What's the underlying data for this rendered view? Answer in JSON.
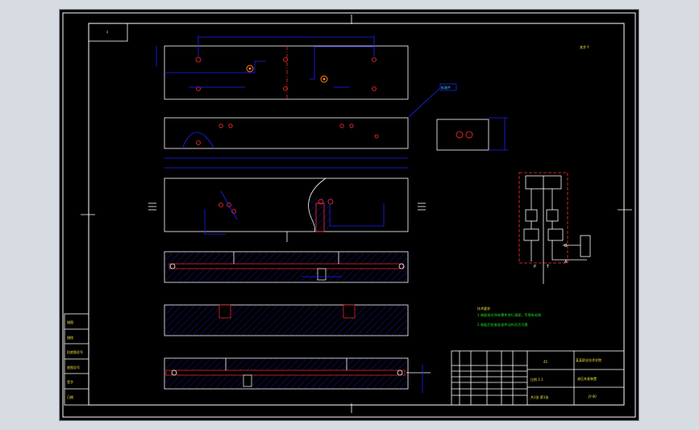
{
  "colors": {
    "background": "#000000",
    "outline": "#ffffff",
    "dimension": "#2020ff",
    "hole": "#ff3030",
    "note": "#20e020"
  },
  "drawing": {
    "corner_tag": "¢",
    "roughness_mark": "其余 ∜",
    "label_tag": "标准件",
    "notes": {
      "heading": "技术要求",
      "lines": [
        "1.装配前对所有零件进行清理，不得有毛刺",
        "2.装配后检查各部件动作灵活可靠"
      ]
    },
    "left_sidebar": [
      "描图",
      "描校",
      "旧底图总号",
      "底图总号",
      "签字",
      "日期"
    ],
    "title_block": {
      "company": "某某职业技术学院",
      "part_name": "液压夹紧装置",
      "drawing_no": "JY-00",
      "material": "45",
      "scale_row": "比例  1:1",
      "sheet": "共1张 第1张"
    },
    "hydraulic_labels": [
      "P",
      "T",
      "A",
      "B"
    ]
  }
}
